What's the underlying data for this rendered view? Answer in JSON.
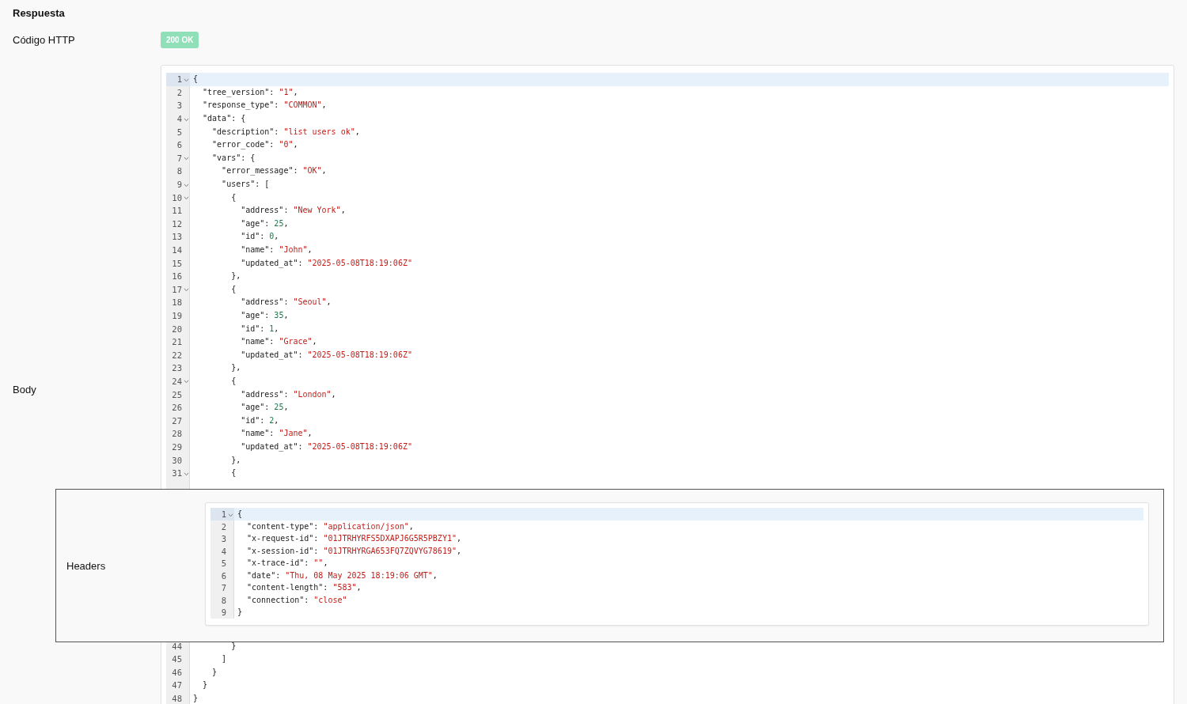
{
  "title": "Respuesta",
  "status": {
    "label": "Código HTTP",
    "badge": "200 OK"
  },
  "body": {
    "label": "Body",
    "lines": [
      {
        "number": "1",
        "foldable": true,
        "active": true,
        "tokens": [
          {
            "kind": "plain",
            "text": "{"
          }
        ]
      },
      {
        "number": "2",
        "foldable": false,
        "active": false,
        "tokens": [
          {
            "kind": "plain",
            "text": "  \"tree_version\": "
          },
          {
            "kind": "string",
            "text": "\"1\""
          },
          {
            "kind": "plain",
            "text": ","
          }
        ]
      },
      {
        "number": "3",
        "foldable": false,
        "active": false,
        "tokens": [
          {
            "kind": "plain",
            "text": "  \"response_type\": "
          },
          {
            "kind": "string",
            "text": "\"COMMON\""
          },
          {
            "kind": "plain",
            "text": ","
          }
        ]
      },
      {
        "number": "4",
        "foldable": true,
        "active": false,
        "tokens": [
          {
            "kind": "plain",
            "text": "  \"data\": {"
          }
        ]
      },
      {
        "number": "5",
        "foldable": false,
        "active": false,
        "tokens": [
          {
            "kind": "plain",
            "text": "    \"description\": "
          },
          {
            "kind": "string",
            "text": "\"list users ok\""
          },
          {
            "kind": "plain",
            "text": ","
          }
        ]
      },
      {
        "number": "6",
        "foldable": false,
        "active": false,
        "tokens": [
          {
            "kind": "plain",
            "text": "    \"error_code\": "
          },
          {
            "kind": "string",
            "text": "\"0\""
          },
          {
            "kind": "plain",
            "text": ","
          }
        ]
      },
      {
        "number": "7",
        "foldable": true,
        "active": false,
        "tokens": [
          {
            "kind": "plain",
            "text": "    \"vars\": {"
          }
        ]
      },
      {
        "number": "8",
        "foldable": false,
        "active": false,
        "tokens": [
          {
            "kind": "plain",
            "text": "      \"error_message\": "
          },
          {
            "kind": "string",
            "text": "\"OK\""
          },
          {
            "kind": "plain",
            "text": ","
          }
        ]
      },
      {
        "number": "9",
        "foldable": true,
        "active": false,
        "tokens": [
          {
            "kind": "plain",
            "text": "      \"users\": ["
          }
        ]
      },
      {
        "number": "10",
        "foldable": true,
        "active": false,
        "tokens": [
          {
            "kind": "plain",
            "text": "        {"
          }
        ]
      },
      {
        "number": "11",
        "foldable": false,
        "active": false,
        "tokens": [
          {
            "kind": "plain",
            "text": "          \"address\": "
          },
          {
            "kind": "string",
            "text": "\"New York\""
          },
          {
            "kind": "plain",
            "text": ","
          }
        ]
      },
      {
        "number": "12",
        "foldable": false,
        "active": false,
        "tokens": [
          {
            "kind": "plain",
            "text": "          \"age\": "
          },
          {
            "kind": "number",
            "text": "25"
          },
          {
            "kind": "plain",
            "text": ","
          }
        ]
      },
      {
        "number": "13",
        "foldable": false,
        "active": false,
        "tokens": [
          {
            "kind": "plain",
            "text": "          \"id\": "
          },
          {
            "kind": "number",
            "text": "0"
          },
          {
            "kind": "plain",
            "text": ","
          }
        ]
      },
      {
        "number": "14",
        "foldable": false,
        "active": false,
        "tokens": [
          {
            "kind": "plain",
            "text": "          \"name\": "
          },
          {
            "kind": "string",
            "text": "\"John\""
          },
          {
            "kind": "plain",
            "text": ","
          }
        ]
      },
      {
        "number": "15",
        "foldable": false,
        "active": false,
        "tokens": [
          {
            "kind": "plain",
            "text": "          \"updated_at\": "
          },
          {
            "kind": "string",
            "text": "\"2025-05-08T18:19:06Z\""
          }
        ]
      },
      {
        "number": "16",
        "foldable": false,
        "active": false,
        "tokens": [
          {
            "kind": "plain",
            "text": "        },"
          }
        ]
      },
      {
        "number": "17",
        "foldable": true,
        "active": false,
        "tokens": [
          {
            "kind": "plain",
            "text": "        {"
          }
        ]
      },
      {
        "number": "18",
        "foldable": false,
        "active": false,
        "tokens": [
          {
            "kind": "plain",
            "text": "          \"address\": "
          },
          {
            "kind": "string",
            "text": "\"Seoul\""
          },
          {
            "kind": "plain",
            "text": ","
          }
        ]
      },
      {
        "number": "19",
        "foldable": false,
        "active": false,
        "tokens": [
          {
            "kind": "plain",
            "text": "          \"age\": "
          },
          {
            "kind": "number",
            "text": "35"
          },
          {
            "kind": "plain",
            "text": ","
          }
        ]
      },
      {
        "number": "20",
        "foldable": false,
        "active": false,
        "tokens": [
          {
            "kind": "plain",
            "text": "          \"id\": "
          },
          {
            "kind": "number",
            "text": "1"
          },
          {
            "kind": "plain",
            "text": ","
          }
        ]
      },
      {
        "number": "21",
        "foldable": false,
        "active": false,
        "tokens": [
          {
            "kind": "plain",
            "text": "          \"name\": "
          },
          {
            "kind": "string",
            "text": "\"Grace\""
          },
          {
            "kind": "plain",
            "text": ","
          }
        ]
      },
      {
        "number": "22",
        "foldable": false,
        "active": false,
        "tokens": [
          {
            "kind": "plain",
            "text": "          \"updated_at\": "
          },
          {
            "kind": "string",
            "text": "\"2025-05-08T18:19:06Z\""
          }
        ]
      },
      {
        "number": "23",
        "foldable": false,
        "active": false,
        "tokens": [
          {
            "kind": "plain",
            "text": "        },"
          }
        ]
      },
      {
        "number": "24",
        "foldable": true,
        "active": false,
        "tokens": [
          {
            "kind": "plain",
            "text": "        {"
          }
        ]
      },
      {
        "number": "25",
        "foldable": false,
        "active": false,
        "tokens": [
          {
            "kind": "plain",
            "text": "          \"address\": "
          },
          {
            "kind": "string",
            "text": "\"London\""
          },
          {
            "kind": "plain",
            "text": ","
          }
        ]
      },
      {
        "number": "26",
        "foldable": false,
        "active": false,
        "tokens": [
          {
            "kind": "plain",
            "text": "          \"age\": "
          },
          {
            "kind": "number",
            "text": "25"
          },
          {
            "kind": "plain",
            "text": ","
          }
        ]
      },
      {
        "number": "27",
        "foldable": false,
        "active": false,
        "tokens": [
          {
            "kind": "plain",
            "text": "          \"id\": "
          },
          {
            "kind": "number",
            "text": "2"
          },
          {
            "kind": "plain",
            "text": ","
          }
        ]
      },
      {
        "number": "28",
        "foldable": false,
        "active": false,
        "tokens": [
          {
            "kind": "plain",
            "text": "          \"name\": "
          },
          {
            "kind": "string",
            "text": "\"Jane\""
          },
          {
            "kind": "plain",
            "text": ","
          }
        ]
      },
      {
        "number": "29",
        "foldable": false,
        "active": false,
        "tokens": [
          {
            "kind": "plain",
            "text": "          \"updated_at\": "
          },
          {
            "kind": "string",
            "text": "\"2025-05-08T18:19:06Z\""
          }
        ]
      },
      {
        "number": "30",
        "foldable": false,
        "active": false,
        "tokens": [
          {
            "kind": "plain",
            "text": "        },"
          }
        ]
      },
      {
        "number": "31",
        "foldable": true,
        "active": false,
        "tokens": [
          {
            "kind": "plain",
            "text": "        {"
          }
        ]
      }
    ],
    "lines_after": [
      {
        "number": "44",
        "foldable": false,
        "active": false,
        "tokens": [
          {
            "kind": "plain",
            "text": "        }"
          }
        ]
      },
      {
        "number": "45",
        "foldable": false,
        "active": false,
        "tokens": [
          {
            "kind": "plain",
            "text": "      ]"
          }
        ]
      },
      {
        "number": "46",
        "foldable": false,
        "active": false,
        "tokens": [
          {
            "kind": "plain",
            "text": "    }"
          }
        ]
      },
      {
        "number": "47",
        "foldable": false,
        "active": false,
        "tokens": [
          {
            "kind": "plain",
            "text": "  }"
          }
        ]
      },
      {
        "number": "48",
        "foldable": false,
        "active": false,
        "tokens": [
          {
            "kind": "plain",
            "text": "}"
          }
        ]
      }
    ]
  },
  "headers": {
    "label": "Headers",
    "lines": [
      {
        "number": "1",
        "foldable": true,
        "active": true,
        "tokens": [
          {
            "kind": "plain",
            "text": "{"
          }
        ]
      },
      {
        "number": "2",
        "foldable": false,
        "active": false,
        "tokens": [
          {
            "kind": "plain",
            "text": "  \"content-type\": "
          },
          {
            "kind": "string",
            "text": "\"application/json\""
          },
          {
            "kind": "plain",
            "text": ","
          }
        ]
      },
      {
        "number": "3",
        "foldable": false,
        "active": false,
        "tokens": [
          {
            "kind": "plain",
            "text": "  \"x-request-id\": "
          },
          {
            "kind": "string",
            "text": "\"01JTRHYRFS5DXAPJ6G5R5PBZY1\""
          },
          {
            "kind": "plain",
            "text": ","
          }
        ]
      },
      {
        "number": "4",
        "foldable": false,
        "active": false,
        "tokens": [
          {
            "kind": "plain",
            "text": "  \"x-session-id\": "
          },
          {
            "kind": "string",
            "text": "\"01JTRHYRGA653FQ7ZQVYG78619\""
          },
          {
            "kind": "plain",
            "text": ","
          }
        ]
      },
      {
        "number": "5",
        "foldable": false,
        "active": false,
        "tokens": [
          {
            "kind": "plain",
            "text": "  \"x-trace-id\": "
          },
          {
            "kind": "string",
            "text": "\"\""
          },
          {
            "kind": "plain",
            "text": ","
          }
        ]
      },
      {
        "number": "6",
        "foldable": false,
        "active": false,
        "tokens": [
          {
            "kind": "plain",
            "text": "  \"date\": "
          },
          {
            "kind": "string",
            "text": "\"Thu, 08 May 2025 18:19:06 GMT\""
          },
          {
            "kind": "plain",
            "text": ","
          }
        ]
      },
      {
        "number": "7",
        "foldable": false,
        "active": false,
        "tokens": [
          {
            "kind": "plain",
            "text": "  \"content-length\": "
          },
          {
            "kind": "string",
            "text": "\"583\""
          },
          {
            "kind": "plain",
            "text": ","
          }
        ]
      },
      {
        "number": "8",
        "foldable": false,
        "active": false,
        "tokens": [
          {
            "kind": "plain",
            "text": "  \"connection\": "
          },
          {
            "kind": "string",
            "text": "\"close\""
          }
        ]
      },
      {
        "number": "9",
        "foldable": false,
        "active": false,
        "tokens": [
          {
            "kind": "plain",
            "text": "}"
          }
        ]
      }
    ]
  }
}
